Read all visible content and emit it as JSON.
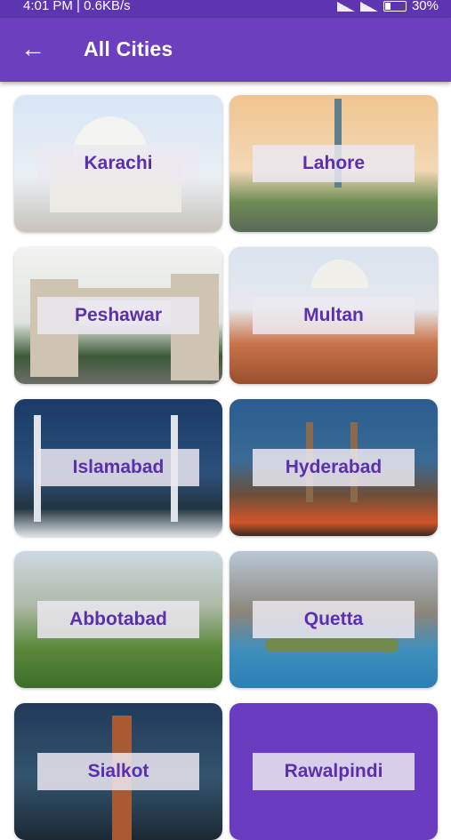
{
  "status_bar": {
    "time_speed": "4:01 PM | 0.6KB/s",
    "battery": "30%"
  },
  "app_bar": {
    "title": "All Cities"
  },
  "cities": [
    {
      "name": "Karachi"
    },
    {
      "name": "Lahore"
    },
    {
      "name": "Peshawar"
    },
    {
      "name": "Multan"
    },
    {
      "name": "Islamabad"
    },
    {
      "name": "Hyderabad"
    },
    {
      "name": "Abbotabad"
    },
    {
      "name": "Quetta"
    },
    {
      "name": "Sialkot"
    },
    {
      "name": "Rawalpindi"
    }
  ],
  "colors": {
    "primary": "#6b3fbe",
    "status": "#5e35b1",
    "label_text": "#5b2fae"
  },
  "icons": {
    "back": "arrow-left-icon"
  }
}
